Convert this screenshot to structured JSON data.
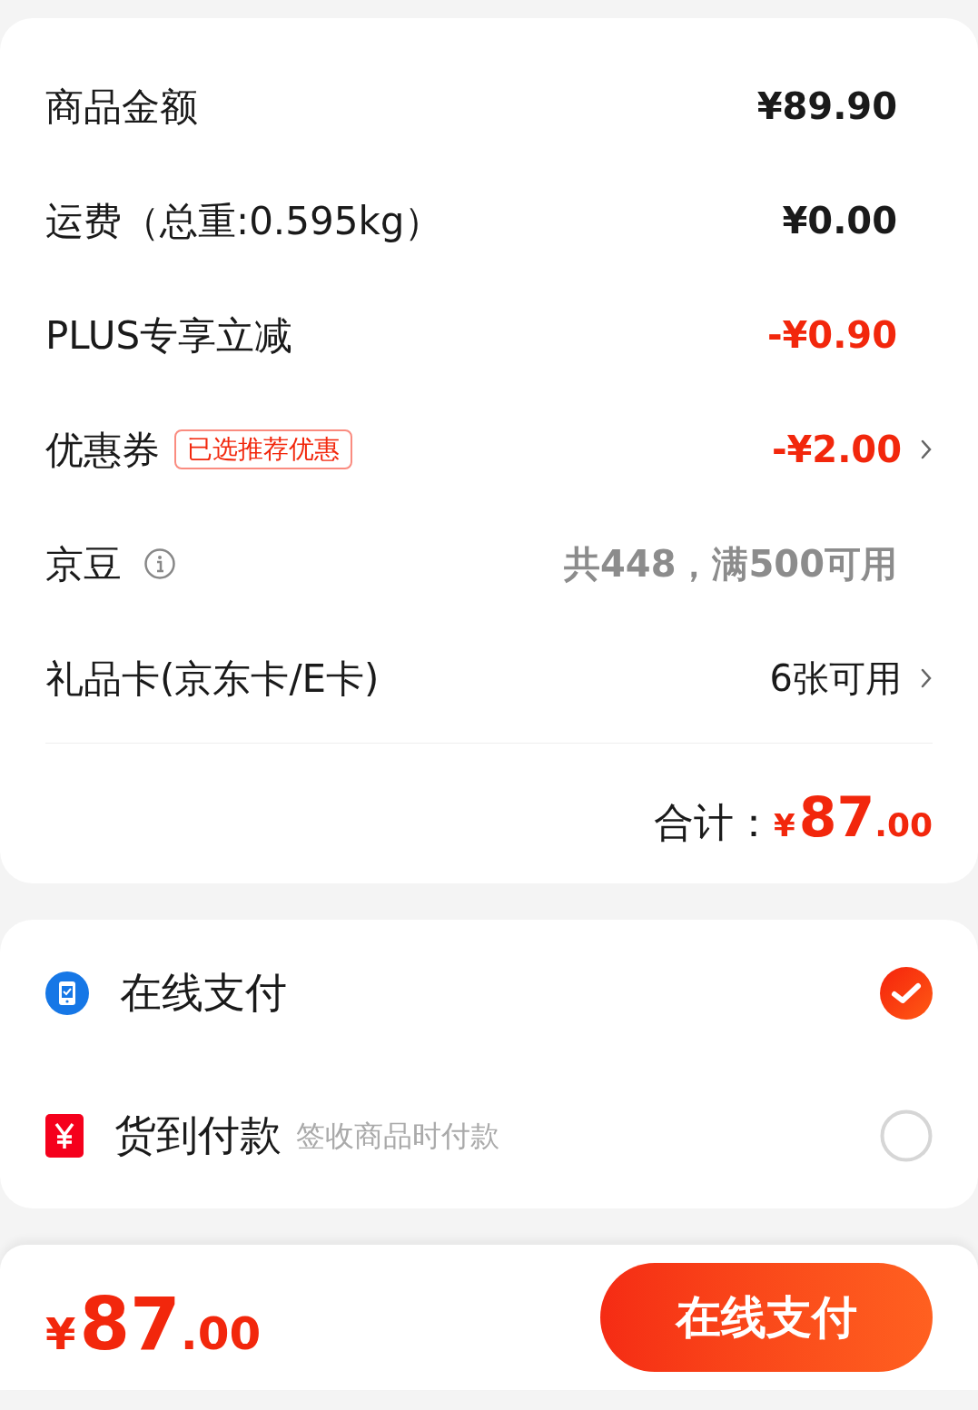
{
  "summary": {
    "rows": [
      {
        "kind": "price",
        "label": "商品金额",
        "value": "¥89.90"
      },
      {
        "kind": "price",
        "label": "运费（总重:0.595kg）",
        "value": "¥0.00"
      },
      {
        "kind": "discount",
        "label": "PLUS专享立减",
        "value": "-¥0.90"
      },
      {
        "kind": "coupon",
        "label": "优惠券",
        "tag": "已选推荐优惠",
        "value": "-¥2.00"
      },
      {
        "kind": "beans",
        "label": "京豆",
        "value": "共448，满500可用"
      },
      {
        "kind": "card",
        "label": "礼品卡(京东卡/E卡)",
        "value": "6张可用"
      }
    ],
    "total": {
      "label": "合计：",
      "currency": "¥",
      "integer": "87",
      "decimal": ".00"
    }
  },
  "payment_methods": [
    {
      "kind": "online",
      "label": "在线支付",
      "selected": true
    },
    {
      "kind": "cod",
      "label": "货到付款",
      "note": "签收商品时付款",
      "selected": false
    }
  ],
  "footer": {
    "currency": "¥",
    "integer": "87",
    "decimal": ".00",
    "button": "在线支付"
  }
}
